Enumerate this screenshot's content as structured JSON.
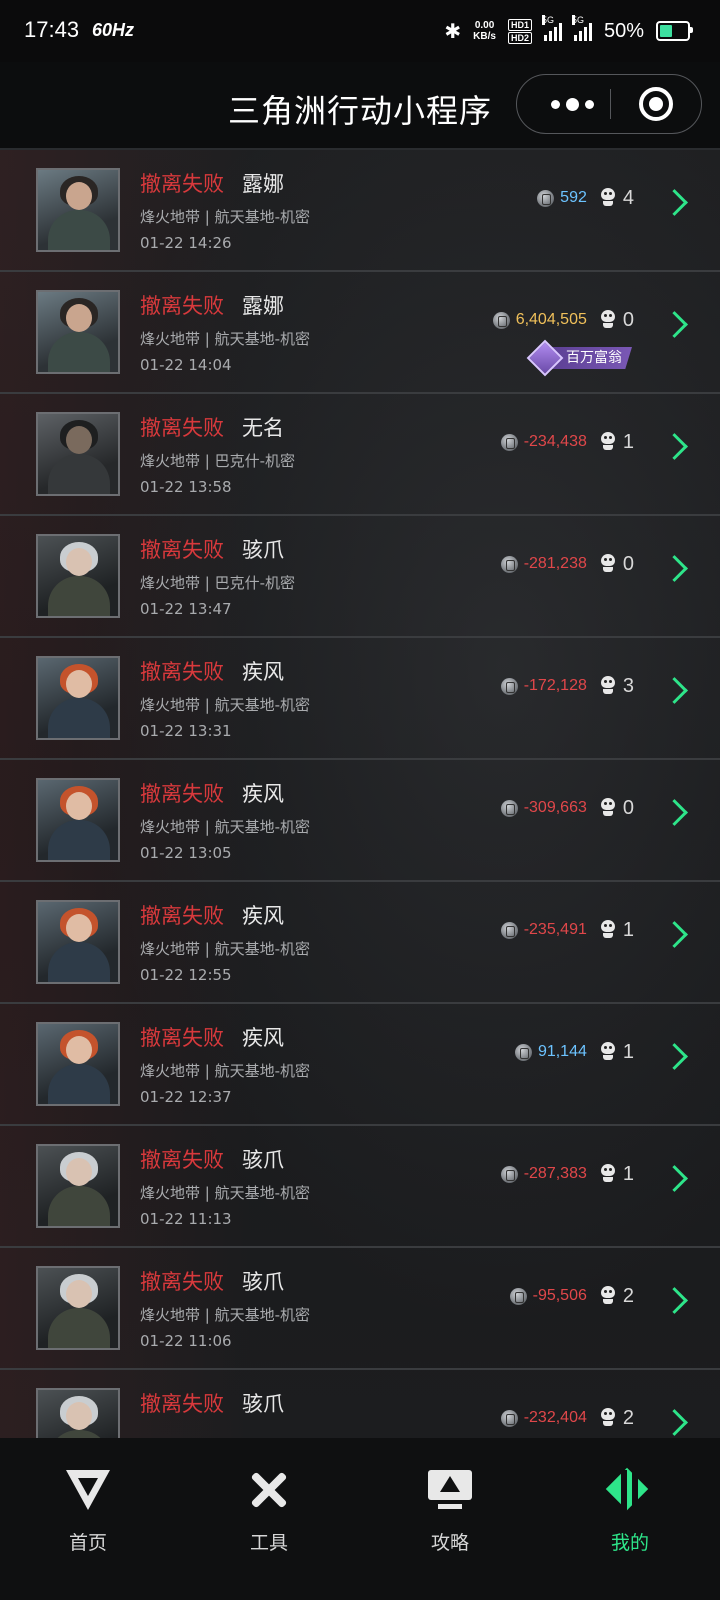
{
  "status_bar": {
    "time": "17:43",
    "refresh": "60Hz",
    "net_speed_value": "0.00",
    "net_speed_unit": "KB/s",
    "hd1": "HD1",
    "hd2": "HD2",
    "sig1": "5G",
    "sig2": "5G",
    "battery_pct": "50%",
    "battery_level": 0.5
  },
  "header": {
    "title": "三角洲行动小程序"
  },
  "colors": {
    "fail_red": "#d8393c",
    "gain_blue": "#6cc3ff",
    "gain_gold": "#f0c05a",
    "loss_red": "#e0474a",
    "accent_green": "#2ee58a"
  },
  "records": [
    {
      "status": "撤离失败",
      "name": "露娜",
      "map": "烽火地带 | 航天基地-机密",
      "time": "01-22 14:26",
      "amount": "592",
      "amount_type": "gain_blue",
      "kills": "4",
      "avatar": "luna"
    },
    {
      "status": "撤离失败",
      "name": "露娜",
      "map": "烽火地带 | 航天基地-机密",
      "time": "01-22 14:04",
      "amount": "6,404,505",
      "amount_type": "gain_gold",
      "kills": "0",
      "avatar": "luna",
      "badge": "百万富翁"
    },
    {
      "status": "撤离失败",
      "name": "无名",
      "map": "烽火地带 | 巴克什-机密",
      "time": "01-22 13:58",
      "amount": "-234,438",
      "amount_type": "loss_red",
      "kills": "1",
      "avatar": "wuming"
    },
    {
      "status": "撤离失败",
      "name": "骇爪",
      "map": "烽火地带 | 巴克什-机密",
      "time": "01-22 13:47",
      "amount": "-281,238",
      "amount_type": "loss_red",
      "kills": "0",
      "avatar": "haizhua"
    },
    {
      "status": "撤离失败",
      "name": "疾风",
      "map": "烽火地带 | 航天基地-机密",
      "time": "01-22 13:31",
      "amount": "-172,128",
      "amount_type": "loss_red",
      "kills": "3",
      "avatar": "jifeng"
    },
    {
      "status": "撤离失败",
      "name": "疾风",
      "map": "烽火地带 | 航天基地-机密",
      "time": "01-22 13:05",
      "amount": "-309,663",
      "amount_type": "loss_red",
      "kills": "0",
      "avatar": "jifeng"
    },
    {
      "status": "撤离失败",
      "name": "疾风",
      "map": "烽火地带 | 航天基地-机密",
      "time": "01-22 12:55",
      "amount": "-235,491",
      "amount_type": "loss_red",
      "kills": "1",
      "avatar": "jifeng"
    },
    {
      "status": "撤离失败",
      "name": "疾风",
      "map": "烽火地带 | 航天基地-机密",
      "time": "01-22 12:37",
      "amount": "91,144",
      "amount_type": "gain_blue",
      "kills": "1",
      "avatar": "jifeng"
    },
    {
      "status": "撤离失败",
      "name": "骇爪",
      "map": "烽火地带 | 航天基地-机密",
      "time": "01-22 11:13",
      "amount": "-287,383",
      "amount_type": "loss_red",
      "kills": "1",
      "avatar": "haizhua"
    },
    {
      "status": "撤离失败",
      "name": "骇爪",
      "map": "烽火地带 | 航天基地-机密",
      "time": "01-22 11:06",
      "amount": "-95,506",
      "amount_type": "loss_red",
      "kills": "2",
      "avatar": "haizhua"
    },
    {
      "status": "撤离失败",
      "name": "骇爪",
      "map": "",
      "time": "",
      "amount": "-232,404",
      "amount_type": "loss_red",
      "kills": "2",
      "avatar": "haizhua"
    }
  ],
  "tabbar": {
    "items": [
      {
        "label": "首页",
        "icon": "home-logo-icon",
        "active": false
      },
      {
        "label": "工具",
        "icon": "tools-icon",
        "active": false
      },
      {
        "label": "攻略",
        "icon": "guide-icon",
        "active": false
      },
      {
        "label": "我的",
        "icon": "mine-icon",
        "active": true
      }
    ]
  }
}
